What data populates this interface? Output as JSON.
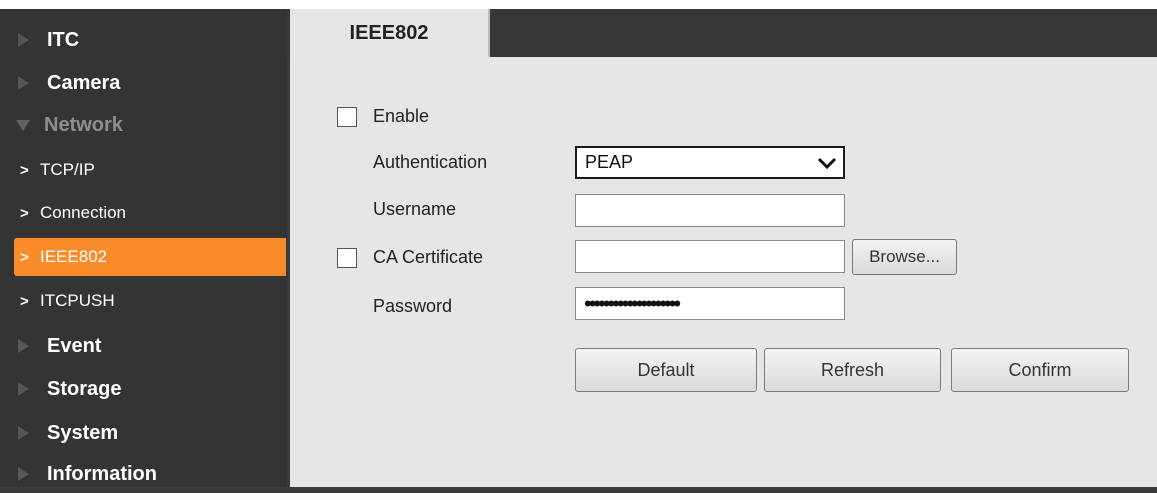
{
  "sidebar": {
    "items": [
      {
        "label": "ITC",
        "type": "main"
      },
      {
        "label": "Camera",
        "type": "main"
      },
      {
        "label": "Network",
        "type": "main",
        "expanded": true
      },
      {
        "label": "TCP/IP",
        "type": "sub"
      },
      {
        "label": "Connection",
        "type": "sub"
      },
      {
        "label": "IEEE802",
        "type": "sub",
        "active": true
      },
      {
        "label": "ITCPUSH",
        "type": "sub"
      },
      {
        "label": "Event",
        "type": "main"
      },
      {
        "label": "Storage",
        "type": "main"
      },
      {
        "label": "System",
        "type": "main"
      },
      {
        "label": "Information",
        "type": "main"
      }
    ],
    "sub_chevron": ">",
    "active_color": "#fa8b2b"
  },
  "tab": {
    "label": "IEEE802"
  },
  "form": {
    "enable": {
      "label": "Enable",
      "checked": false
    },
    "authentication": {
      "label": "Authentication",
      "value": "PEAP"
    },
    "username": {
      "label": "Username",
      "value": ""
    },
    "ca_certificate": {
      "label": "CA Certificate",
      "checked": false,
      "value": "",
      "browse_label": "Browse..."
    },
    "password": {
      "label": "Password",
      "masked_value": "••••••••••••••••••••"
    }
  },
  "buttons": {
    "default": "Default",
    "refresh": "Refresh",
    "confirm": "Confirm"
  },
  "icons": {
    "expand": "triangle-right-icon",
    "expanded": "triangle-down-icon",
    "sub": "chevron-right-icon",
    "select": "chevron-down-icon"
  }
}
